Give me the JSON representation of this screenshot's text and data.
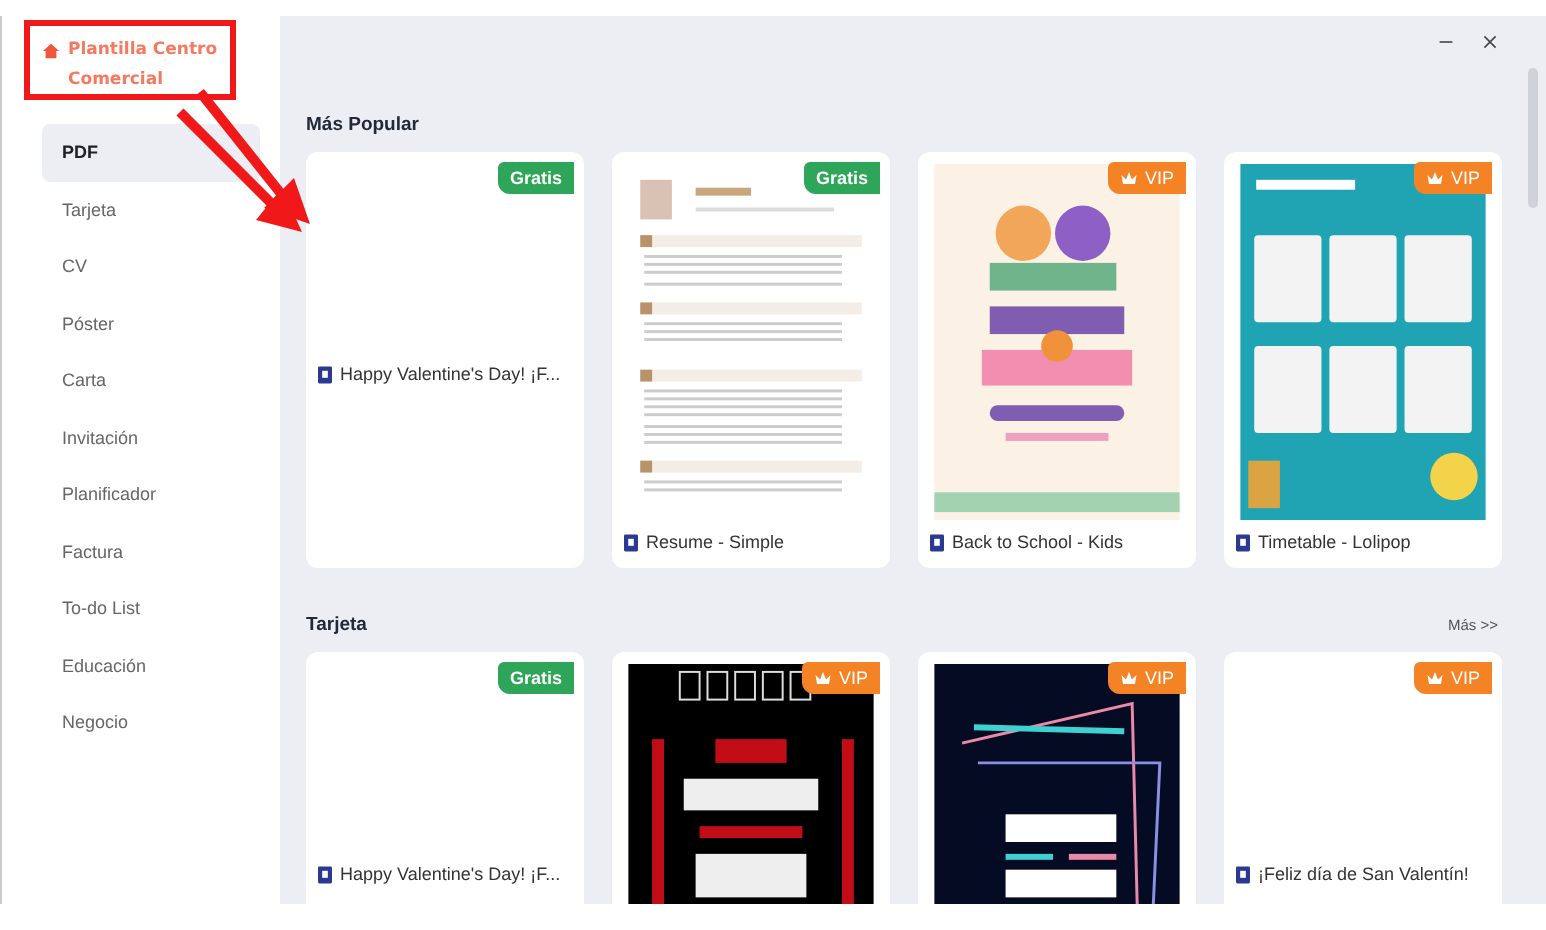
{
  "sidebar": {
    "brand": "Plantilla Centro Comercial",
    "items": [
      {
        "label": "PDF",
        "selected": true
      },
      {
        "label": "Tarjeta",
        "selected": false
      },
      {
        "label": "CV",
        "selected": false
      },
      {
        "label": "Póster",
        "selected": false
      },
      {
        "label": "Carta",
        "selected": false
      },
      {
        "label": "Invitación",
        "selected": false
      },
      {
        "label": "Planificador",
        "selected": false
      },
      {
        "label": "Factura",
        "selected": false
      },
      {
        "label": "To-do List",
        "selected": false
      },
      {
        "label": "Educación",
        "selected": false
      },
      {
        "label": "Negocio",
        "selected": false
      }
    ]
  },
  "sections": [
    {
      "title": "Más Popular",
      "cards": [
        {
          "kind": "blank",
          "title": "Happy Valentine's Day!  ¡F...",
          "badge": {
            "kind": "free",
            "label": "Gratis"
          }
        },
        {
          "kind": "resume",
          "title": "Resume - Simple",
          "badge": {
            "kind": "free",
            "label": "Gratis"
          }
        },
        {
          "kind": "school",
          "title": "Back to School - Kids",
          "badge": {
            "kind": "vip",
            "label": "VIP"
          }
        },
        {
          "kind": "timetable",
          "title": "Timetable - Lolipop",
          "badge": {
            "kind": "vip",
            "label": "VIP"
          }
        }
      ]
    },
    {
      "title": "Tarjeta",
      "more": "Más >>",
      "cards": [
        {
          "kind": "blank",
          "title": "Happy Valentine's Day!  ¡F...",
          "badge": {
            "kind": "free",
            "label": "Gratis"
          }
        },
        {
          "kind": "sale",
          "badge": {
            "kind": "vip",
            "label": "VIP"
          }
        },
        {
          "kind": "night",
          "badge": {
            "kind": "vip",
            "label": "VIP"
          }
        },
        {
          "kind": "blank",
          "title": "¡Feliz día de San Valentín!",
          "badge": {
            "kind": "vip",
            "label": "VIP"
          }
        }
      ]
    }
  ]
}
